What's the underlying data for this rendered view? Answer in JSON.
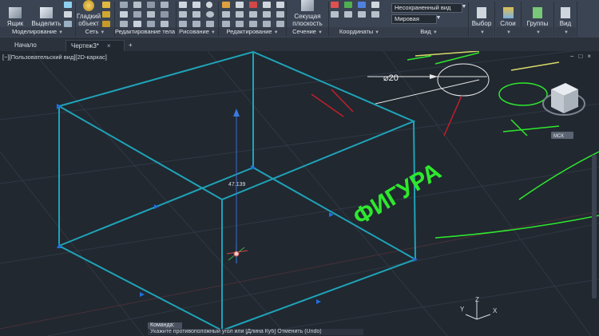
{
  "ribbon": {
    "box_button": "Ящик",
    "extract_button": "Выделить",
    "smooth_object_button": "Гладкий объект",
    "section_plane_button": "Секущая плоскость",
    "visual_style_combo": "Несохраненный вид",
    "ucs_combo": "Мировая",
    "select_button": "Выбор",
    "layers_button": "Слои",
    "groups_button": "Группы",
    "view_button": "Вид",
    "panels": {
      "modeling": "Моделирование",
      "mesh": "Сеть",
      "solid_editing": "Редактирование тела",
      "draw": "Рисование",
      "modify": "Редактирование",
      "section": "Сечение",
      "coordinates": "Координаты",
      "view": "Вид"
    }
  },
  "tabs": {
    "start": "Начало",
    "drawing": "Чертеж3*",
    "close": "×",
    "add": "+"
  },
  "viewport": {
    "label": "[−][Пользовательский вид][2D-каркас]",
    "window_buttons": "−□×",
    "dimension_value": "47.139",
    "circle_dimension": "⌀20",
    "figure_text": "ФИГУРА",
    "viewcube_wcs": "МСК",
    "axis_x": "X",
    "axis_y": "Y",
    "axis_z": "Z"
  },
  "command": {
    "prompt": "Команда:",
    "line": "Укажите противоположный угол или [Длина Куб] Отменить (Undo)"
  },
  "colors": {
    "ribbon_bg": "#3b4453",
    "viewport_bg": "#212830",
    "cube_edges": "#1fa3b8",
    "figure_text": "#2ee82e",
    "dimension_red": "#c0202a",
    "grip_blue": "#1f6fe0"
  }
}
